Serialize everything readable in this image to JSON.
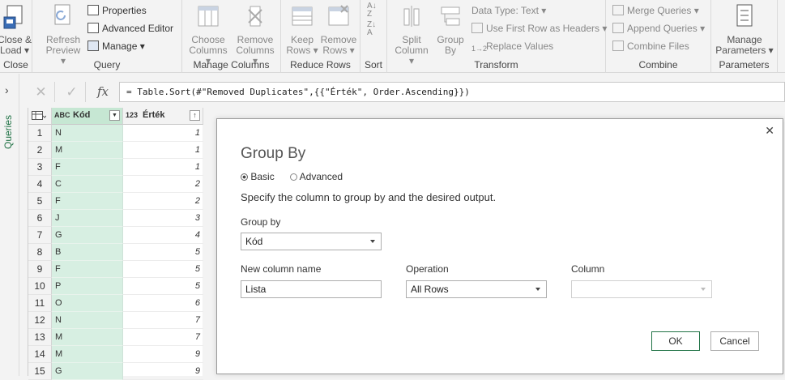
{
  "ribbon": {
    "groups": {
      "close": "Close",
      "query": "Query",
      "manage_columns": "Manage Columns",
      "reduce_rows": "Reduce Rows",
      "sort": "Sort",
      "transform": "Transform",
      "combine": "Combine",
      "parameters": "Parameters"
    },
    "close_load": [
      "Close &",
      "Load"
    ],
    "refresh_preview": [
      "Refresh",
      "Preview"
    ],
    "properties": "Properties",
    "advanced_editor": "Advanced Editor",
    "manage": "Manage",
    "choose_columns": [
      "Choose",
      "Columns"
    ],
    "remove_columns": [
      "Remove",
      "Columns"
    ],
    "keep_rows": [
      "Keep",
      "Rows"
    ],
    "remove_rows": [
      "Remove",
      "Rows"
    ],
    "split_column": [
      "Split",
      "Column"
    ],
    "group_by": [
      "Group",
      "By"
    ],
    "data_type": "Data Type: Text",
    "use_first_row": "Use First Row as Headers",
    "replace_values": "Replace Values",
    "merge_queries": "Merge Queries",
    "append_queries": "Append Queries",
    "combine_files": "Combine Files",
    "manage_parameters": [
      "Manage",
      "Parameters"
    ]
  },
  "sidebar": {
    "label": "Queries"
  },
  "formula_bar": {
    "fx": "fx",
    "formula": "= Table.Sort(#\"Removed Duplicates\",{{\"Érték\", Order.Ascending}})"
  },
  "grid": {
    "col1_type": "ABC",
    "col1": "Kód",
    "col2_type": "123",
    "col2": "Érték",
    "rows": [
      {
        "n": "1",
        "kod": "N",
        "ertek": "1"
      },
      {
        "n": "2",
        "kod": "M",
        "ertek": "1"
      },
      {
        "n": "3",
        "kod": "F",
        "ertek": "1"
      },
      {
        "n": "4",
        "kod": "C",
        "ertek": "2"
      },
      {
        "n": "5",
        "kod": "F",
        "ertek": "2"
      },
      {
        "n": "6",
        "kod": "J",
        "ertek": "3"
      },
      {
        "n": "7",
        "kod": "G",
        "ertek": "4"
      },
      {
        "n": "8",
        "kod": "B",
        "ertek": "5"
      },
      {
        "n": "9",
        "kod": "F",
        "ertek": "5"
      },
      {
        "n": "10",
        "kod": "P",
        "ertek": "5"
      },
      {
        "n": "11",
        "kod": "O",
        "ertek": "6"
      },
      {
        "n": "12",
        "kod": "N",
        "ertek": "7"
      },
      {
        "n": "13",
        "kod": "M",
        "ertek": "7"
      },
      {
        "n": "14",
        "kod": "M",
        "ertek": "9"
      },
      {
        "n": "15",
        "kod": "G",
        "ertek": "9"
      }
    ]
  },
  "dialog": {
    "title": "Group By",
    "basic": "Basic",
    "advanced": "Advanced",
    "description": "Specify the column to group by and the desired output.",
    "group_by_label": "Group by",
    "group_by_value": "Kód",
    "new_col_label": "New column name",
    "new_col_value": "Lista",
    "operation_label": "Operation",
    "operation_value": "All Rows",
    "column_label": "Column",
    "column_value": "",
    "ok": "OK",
    "cancel": "Cancel",
    "close": "✕"
  },
  "colors": {
    "accent": "#217346",
    "selected_column": "#d7efe2"
  }
}
